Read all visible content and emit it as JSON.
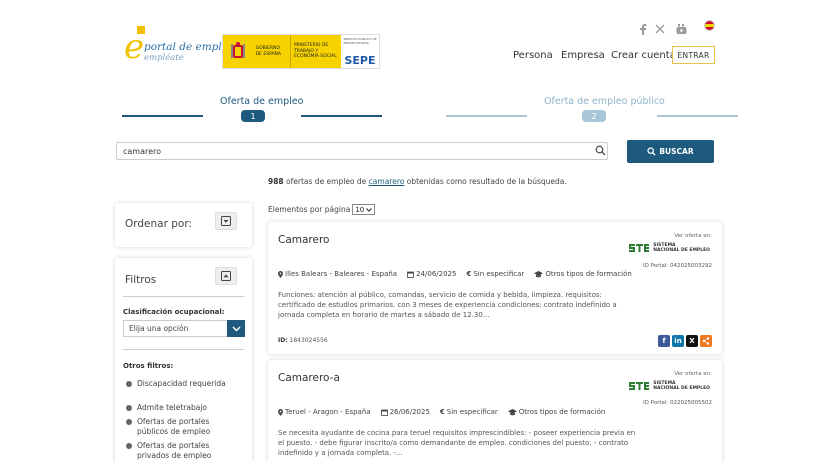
{
  "brand": {
    "logo_name": "portal de empleo",
    "logo_sub": "empléate",
    "gov_label": "GOBIERNO DE ESPAÑA",
    "ministry_label": "MINISTERIO DE TRABAJO Y ECONOMÍA SOCIAL",
    "sepe_small": "SERVICIO PÚBLICO DE EMPLEO ESTATAL",
    "sepe_word": "SEPE"
  },
  "social_icons": [
    "facebook-icon",
    "x-icon",
    "youtube-icon"
  ],
  "nav": {
    "persona": "Persona",
    "empresa": "Empresa",
    "crear_cuenta": "Crear cuenta",
    "entrar": "ENTRAR"
  },
  "tabs": [
    {
      "label": "Oferta de empleo",
      "number": "1",
      "active": true
    },
    {
      "label": "Oferta de empleo público",
      "number": "2",
      "active": false
    }
  ],
  "search": {
    "value": "camarero",
    "button_label": "BUSCAR"
  },
  "results": {
    "count": "988",
    "pre": "ofertas de empleo de",
    "term": "camarero",
    "post": "obtenidas como resultado de la búsqueda."
  },
  "sort_panel": {
    "title": "Ordenar por:"
  },
  "filters": {
    "title": "Filtros",
    "occupational_label": "Clasificación ocupacional:",
    "occupational_placeholder": "Elija una opción",
    "other_label": "Otros filtros:",
    "items": [
      "Discapacidad requerida",
      "Admite teletrabajo",
      "Ofertas de portales públicos de empleo",
      "Ofertas de portales privados de empleo"
    ]
  },
  "per_page": {
    "label": "Elementos por página",
    "value": "10"
  },
  "offers": [
    {
      "title": "Camarero",
      "ver_oferta": "Ver oferta en:",
      "source_line1": "SISTEMA",
      "source_line2": "NACIONAL DE EMPLEO",
      "portal_id": "ID Portal: 042025003292",
      "location": "Illes Balears - Baleares - España",
      "date": "24/06/2025",
      "salary": "Sin especificar",
      "education": "Otros tipos de formación",
      "description": "Funciones: atención al público, comandas, servicio de comida y bebida, limpieza. requisitos: certificado de estudios primarios. con 3 meses de experiencia condiciones: contrato indefinido a jornada completa en horario de martes a sábado de 12.30...",
      "id_label": "ID:",
      "id_value": "1843024556"
    },
    {
      "title": "Camarero-a",
      "ver_oferta": "Ver oferta en:",
      "source_line1": "SISTEMA",
      "source_line2": "NACIONAL DE EMPLEO",
      "portal_id": "ID Portal: 022025005502",
      "location": "Teruel - Aragon - España",
      "date": "26/06/2025",
      "salary": "Sin especificar",
      "education": "Otros tipos de formación",
      "description": "Se necesita ayudante de cocina para teruel requisitos imprescindibles: - poseer experiencia previa en el puesto. - debe figurar inscrito/a como demandante de empleo. condiciones del puesto: - contrato indefinido y a jornada completa. -..."
    }
  ],
  "colors": {
    "primary": "#1d5a7e",
    "accent_yellow": "#f2c200",
    "tab_inactive": "#a8c6d6"
  }
}
